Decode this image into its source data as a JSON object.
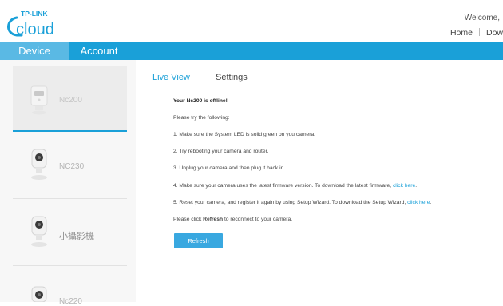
{
  "header": {
    "logo_line1": "TP-LINK",
    "logo_line2": "cloud",
    "welcome": "Welcome,",
    "links": [
      "Home",
      "Dow"
    ]
  },
  "nav": {
    "tabs": [
      {
        "label": "Device",
        "active": true
      },
      {
        "label": "Account",
        "active": false
      }
    ]
  },
  "devices": [
    {
      "name": "Nc200",
      "selected": true
    },
    {
      "name": "NC230",
      "selected": false
    },
    {
      "name": "小攝影機",
      "selected": false
    },
    {
      "name": "Nc220",
      "selected": false
    }
  ],
  "content": {
    "tabs": {
      "live_view": "Live View",
      "settings": "Settings"
    },
    "offline_title": "Your Nc200 is offline!",
    "intro": "Please try the following:",
    "steps": {
      "s1": "1. Make sure the System LED is solid green on you camera.",
      "s2": "2. Try rebooting your camera and router.",
      "s3": "3. Unplug your camera and then plug it back in.",
      "s4_text": "4. Make sure your camera uses the latest firmware version. To download the latest firmware,",
      "s4_link": "click here",
      "s4_end": ".",
      "s5_text": "5. Reset your camera, and register it again by using Setup Wizard. To download the Setup Wizard,",
      "s5_link": "click here",
      "s5_end": "."
    },
    "refresh_note_pre": "Please click",
    "refresh_note_bold": "Refresh",
    "refresh_note_post": "to reconnect to your camera.",
    "refresh_button": "Refresh"
  },
  "colors": {
    "accent": "#1aa0d8",
    "button": "#39a8e0"
  }
}
